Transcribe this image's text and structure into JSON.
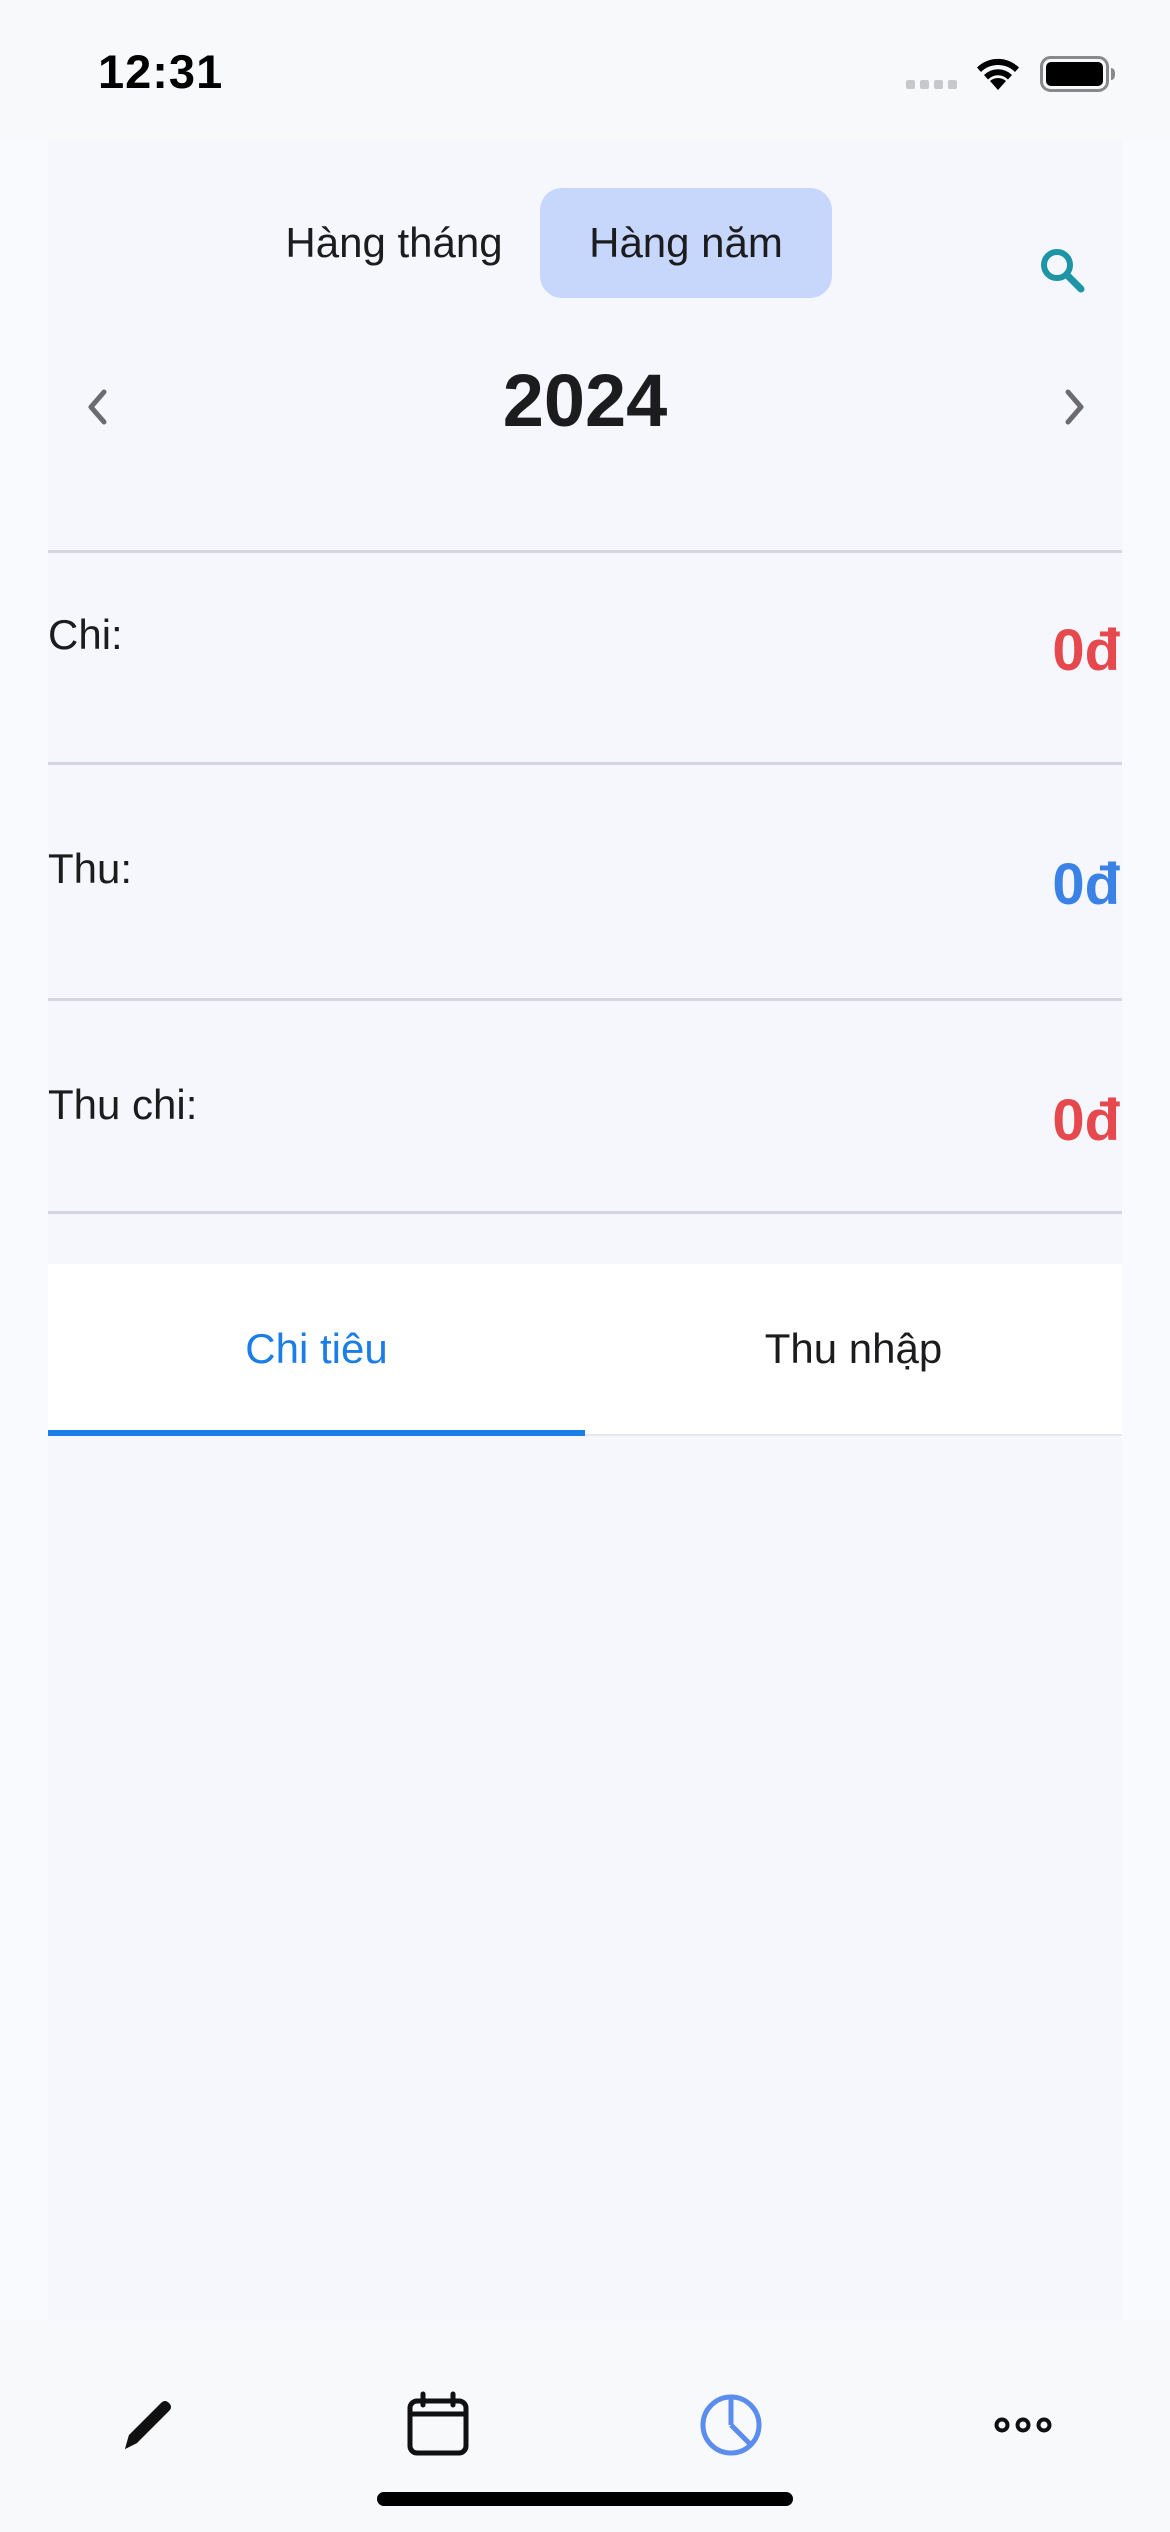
{
  "status_bar": {
    "time": "12:31"
  },
  "period_selector": {
    "monthly_label": "Hàng tháng",
    "yearly_label": "Hàng năm",
    "selected": "Hàng năm",
    "search_icon": "search-icon"
  },
  "year_nav": {
    "year": "2024",
    "prev_icon": "chevron-left-icon",
    "next_icon": "chevron-right-icon"
  },
  "summary": {
    "expense_label": "Chi:",
    "expense_value": "0đ",
    "income_label": "Thu:",
    "income_value": "0đ",
    "balance_label": "Thu chi:",
    "balance_value": "0đ"
  },
  "tabs": {
    "expense_label": "Chi tiêu",
    "income_label": "Thu nhập",
    "active": "Chi tiêu"
  },
  "bottom_nav": {
    "items": [
      {
        "icon": "pencil-icon"
      },
      {
        "icon": "calendar-icon"
      },
      {
        "icon": "pie-chart-icon",
        "active": true
      },
      {
        "icon": "more-icon"
      }
    ]
  },
  "colors": {
    "expense": "#e5484d",
    "income": "#3b82e6",
    "accent": "#1a7ee6",
    "selected_segment": "#c6d7fb",
    "search_icon": "#1e95a6"
  }
}
